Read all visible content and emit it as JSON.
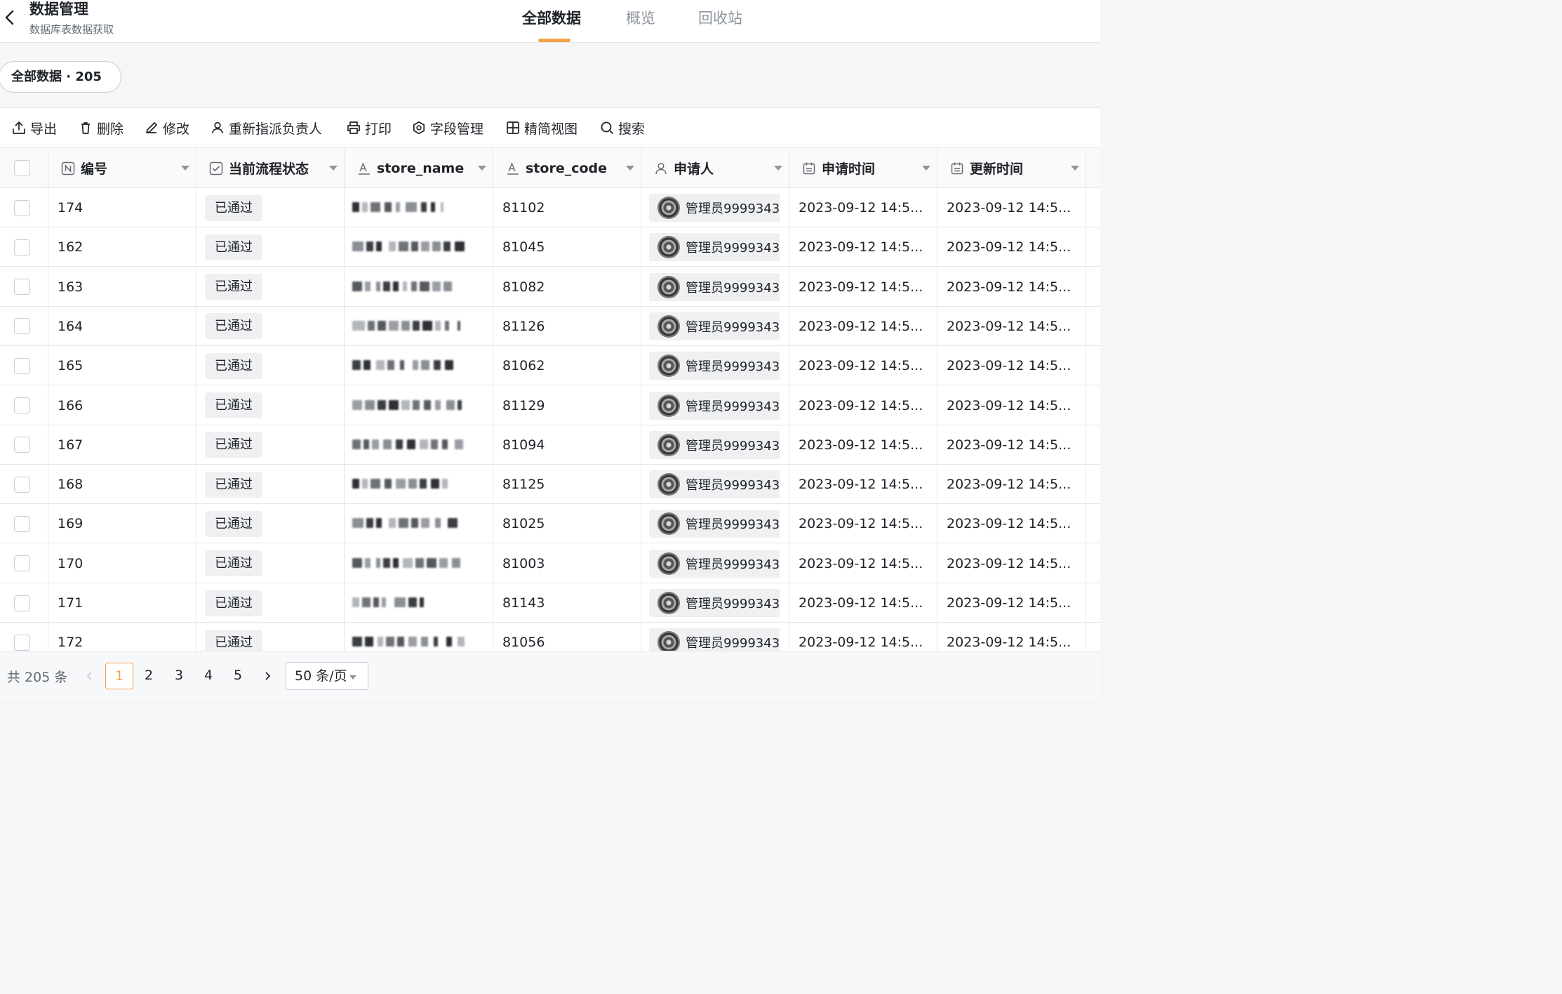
{
  "header": {
    "title": "数据管理",
    "subtitle": "数据库表数据获取",
    "tabs": [
      {
        "label": "全部数据",
        "active": true
      },
      {
        "label": "概览",
        "active": false
      },
      {
        "label": "回收站",
        "active": false
      }
    ],
    "accent_color": "#f5a14a"
  },
  "count_pill": "全部数据 · 205",
  "toolbar": {
    "export": "导出",
    "delete": "删除",
    "modify": "修改",
    "reassign": "重新指派负责人",
    "print": "打印",
    "fields": "字段管理",
    "compact_view": "精简视图",
    "search": "搜索"
  },
  "table": {
    "columns": [
      "编号",
      "当前流程状态",
      "store_name",
      "store_code",
      "申请人",
      "申请时间",
      "更新时间"
    ],
    "rows": [
      {
        "id": "174",
        "status": "已通过",
        "store_code": "81102",
        "applicant": "管理员9999343",
        "applied": "2023-09-12 14:5...",
        "updated": "2023-09-12 14:5..."
      },
      {
        "id": "162",
        "status": "已通过",
        "store_code": "81045",
        "applicant": "管理员9999343",
        "applied": "2023-09-12 14:5...",
        "updated": "2023-09-12 14:5..."
      },
      {
        "id": "163",
        "status": "已通过",
        "store_code": "81082",
        "applicant": "管理员9999343",
        "applied": "2023-09-12 14:5...",
        "updated": "2023-09-12 14:5..."
      },
      {
        "id": "164",
        "status": "已通过",
        "store_code": "81126",
        "applicant": "管理员9999343",
        "applied": "2023-09-12 14:5...",
        "updated": "2023-09-12 14:5..."
      },
      {
        "id": "165",
        "status": "已通过",
        "store_code": "81062",
        "applicant": "管理员9999343",
        "applied": "2023-09-12 14:5...",
        "updated": "2023-09-12 14:5..."
      },
      {
        "id": "166",
        "status": "已通过",
        "store_code": "81129",
        "applicant": "管理员9999343",
        "applied": "2023-09-12 14:5...",
        "updated": "2023-09-12 14:5..."
      },
      {
        "id": "167",
        "status": "已通过",
        "store_code": "81094",
        "applicant": "管理员9999343",
        "applied": "2023-09-12 14:5...",
        "updated": "2023-09-12 14:5..."
      },
      {
        "id": "168",
        "status": "已通过",
        "store_code": "81125",
        "applicant": "管理员9999343",
        "applied": "2023-09-12 14:5...",
        "updated": "2023-09-12 14:5..."
      },
      {
        "id": "169",
        "status": "已通过",
        "store_code": "81025",
        "applicant": "管理员9999343",
        "applied": "2023-09-12 14:5...",
        "updated": "2023-09-12 14:5..."
      },
      {
        "id": "170",
        "status": "已通过",
        "store_code": "81003",
        "applicant": "管理员9999343",
        "applied": "2023-09-12 14:5...",
        "updated": "2023-09-12 14:5..."
      },
      {
        "id": "171",
        "status": "已通过",
        "store_code": "81143",
        "applicant": "管理员9999343",
        "applied": "2023-09-12 14:5...",
        "updated": "2023-09-12 14:5..."
      },
      {
        "id": "172",
        "status": "已通过",
        "store_code": "81056",
        "applicant": "管理员9999343",
        "applied": "2023-09-12 14:5...",
        "updated": "2023-09-12 14:5..."
      }
    ]
  },
  "pagination": {
    "total": "共 205 条",
    "pages": [
      "1",
      "2",
      "3",
      "4",
      "5"
    ],
    "current": "1",
    "page_size": "50 条/页"
  }
}
